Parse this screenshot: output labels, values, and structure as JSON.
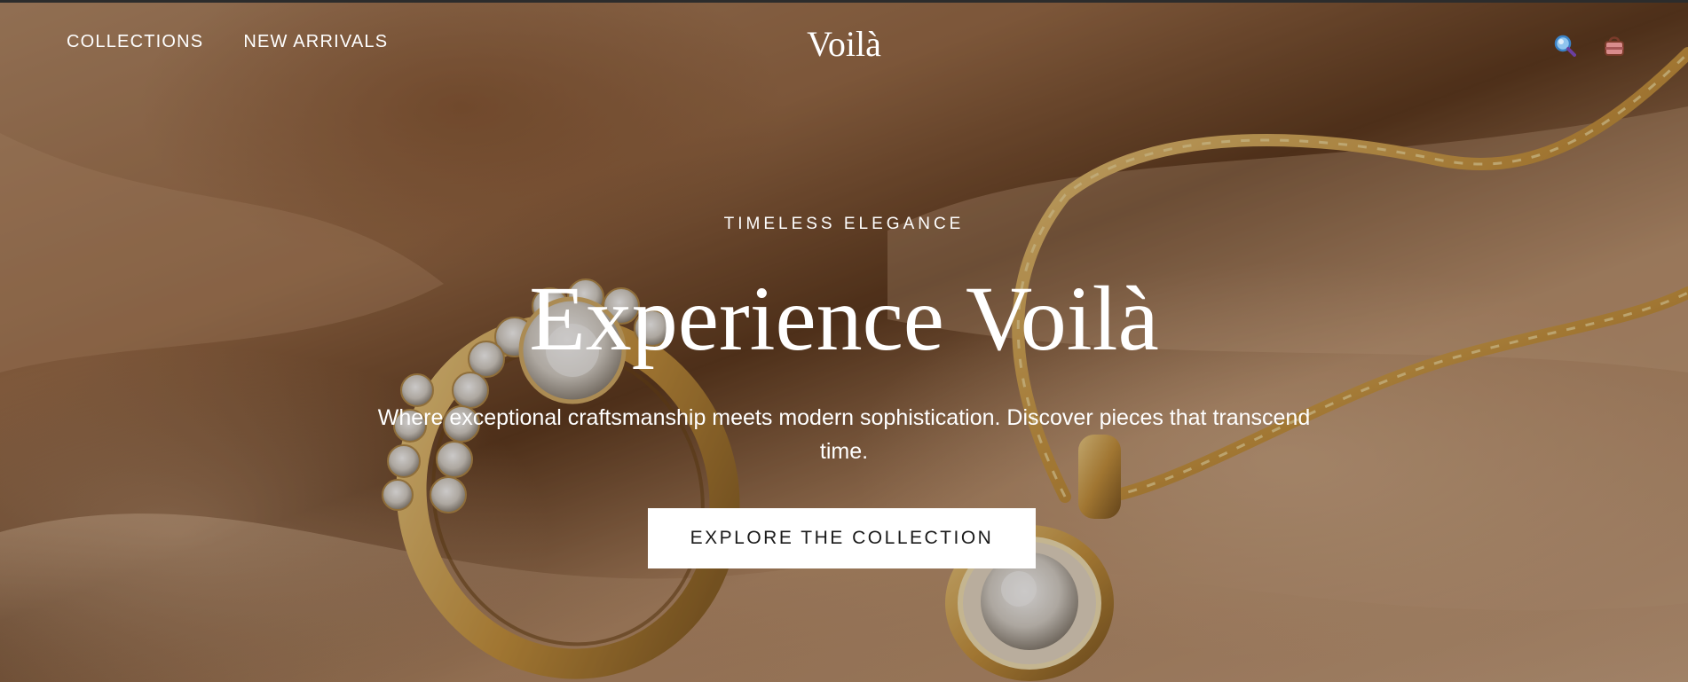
{
  "header": {
    "nav_items": [
      "COLLECTIONS",
      "NEW ARRIVALS"
    ],
    "logo": "Voilà",
    "icons": [
      "search-icon",
      "bag-icon"
    ]
  },
  "hero": {
    "eyebrow": "TIMELESS ELEGANCE",
    "headline": "Experience Voilà",
    "subtext": "Where exceptional craftsmanship meets modern sophistication. Discover pieces that transcend time.",
    "cta_label": "EXPLORE THE COLLECTION",
    "background_image": "diamond ring and gold chain pendant on satin"
  },
  "colors": {
    "text": "#ffffff",
    "button_bg": "#ffffff",
    "button_text": "#1a1a1a",
    "gold": "#d4a24c"
  }
}
